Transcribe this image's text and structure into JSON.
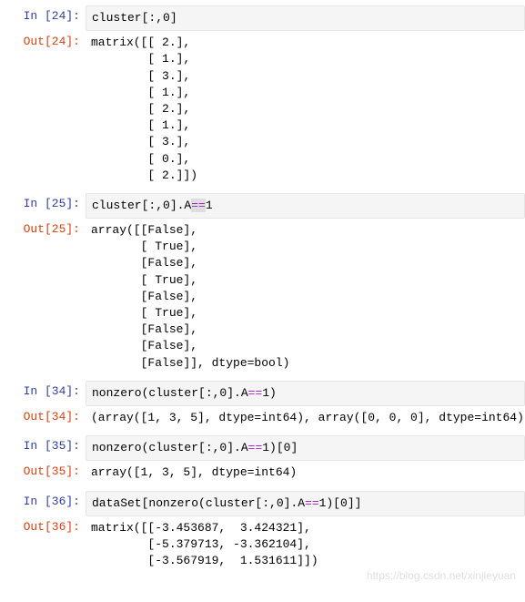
{
  "cells": [
    {
      "in_prompt": "In [24]:",
      "in_code": "cluster[:,0]",
      "out_prompt": "Out[24]:",
      "out_text": "matrix([[ 2.],\n        [ 1.],\n        [ 3.],\n        [ 1.],\n        [ 2.],\n        [ 1.],\n        [ 3.],\n        [ 0.],\n        [ 2.]])"
    },
    {
      "in_prompt": "In [25]:",
      "in_code_pre": "cluster[:,0].A",
      "in_code_eq": "==",
      "in_code_post": "1",
      "out_prompt": "Out[25]:",
      "out_text": "array([[False],\n       [ True],\n       [False],\n       [ True],\n       [False],\n       [ True],\n       [False],\n       [False],\n       [False]], dtype=bool)"
    },
    {
      "in_prompt": "In [34]:",
      "in_code_pre": "nonzero(cluster[:,0].A",
      "in_code_eq": "==",
      "in_code_post": "1)",
      "out_prompt": "Out[34]:",
      "out_text": "(array([1, 3, 5], dtype=int64), array([0, 0, 0], dtype=int64))"
    },
    {
      "in_prompt": "In [35]:",
      "in_code_pre": "nonzero(cluster[:,0].A",
      "in_code_eq": "==",
      "in_code_post": "1)[0]",
      "out_prompt": "Out[35]:",
      "out_text": "array([1, 3, 5], dtype=int64)"
    },
    {
      "in_prompt": "In [36]:",
      "in_code_pre": "dataSet[nonzero(cluster[:,0].A",
      "in_code_eq": "==",
      "in_code_post": "1)[0]]",
      "out_prompt": "Out[36]:",
      "out_text": "matrix([[-3.453687,  3.424321],\n        [-5.379713, -3.362104],\n        [-3.567919,  1.531611]])"
    }
  ],
  "watermark": "https://blog.csdn.net/xinjieyuan"
}
